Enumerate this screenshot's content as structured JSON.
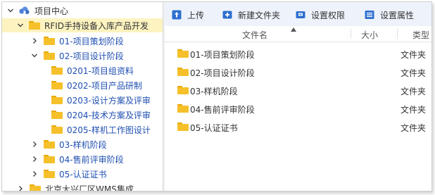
{
  "tree": {
    "root": "项目中心",
    "project": "RFID手持设备入库产品开发",
    "items": [
      {
        "label": "01-项目策划阶段",
        "expanded": false
      },
      {
        "label": "02-项目设计阶段",
        "expanded": true
      },
      {
        "label": "0201-项目组资料"
      },
      {
        "label": "0202-项目产品研制"
      },
      {
        "label": "0203-设计方案及评审"
      },
      {
        "label": "0204-技术方案及评审"
      },
      {
        "label": "0205-样机工作图设计"
      },
      {
        "label": "03-样机阶段",
        "expanded": false
      },
      {
        "label": "04-售前评审阶段",
        "expanded": false
      },
      {
        "label": "05-认证证书",
        "expanded": false
      }
    ],
    "other_project": "北京大兴厂区WMS集成"
  },
  "toolbar": {
    "upload": "上传",
    "new_folder": "新建文件夹",
    "permissions": "设置权限",
    "properties": "设置属性"
  },
  "columns": {
    "name": "文件名",
    "size": "大小",
    "type": "类型"
  },
  "files": [
    {
      "name": "01-项目策划阶段",
      "size": "",
      "type": "文件夹"
    },
    {
      "name": "02-项目设计阶段",
      "size": "",
      "type": "文件夹"
    },
    {
      "name": "03-样机阶段",
      "size": "",
      "type": "文件夹"
    },
    {
      "name": "04-售前评审阶段",
      "size": "",
      "type": "文件夹"
    },
    {
      "name": "05-认证证书",
      "size": "",
      "type": "文件夹"
    }
  ],
  "colors": {
    "accent": "#1f6fd1",
    "selected_bg": "#fdf3c0",
    "toolbar_bg": "#eef3fb",
    "folder": "#f5c02a"
  }
}
